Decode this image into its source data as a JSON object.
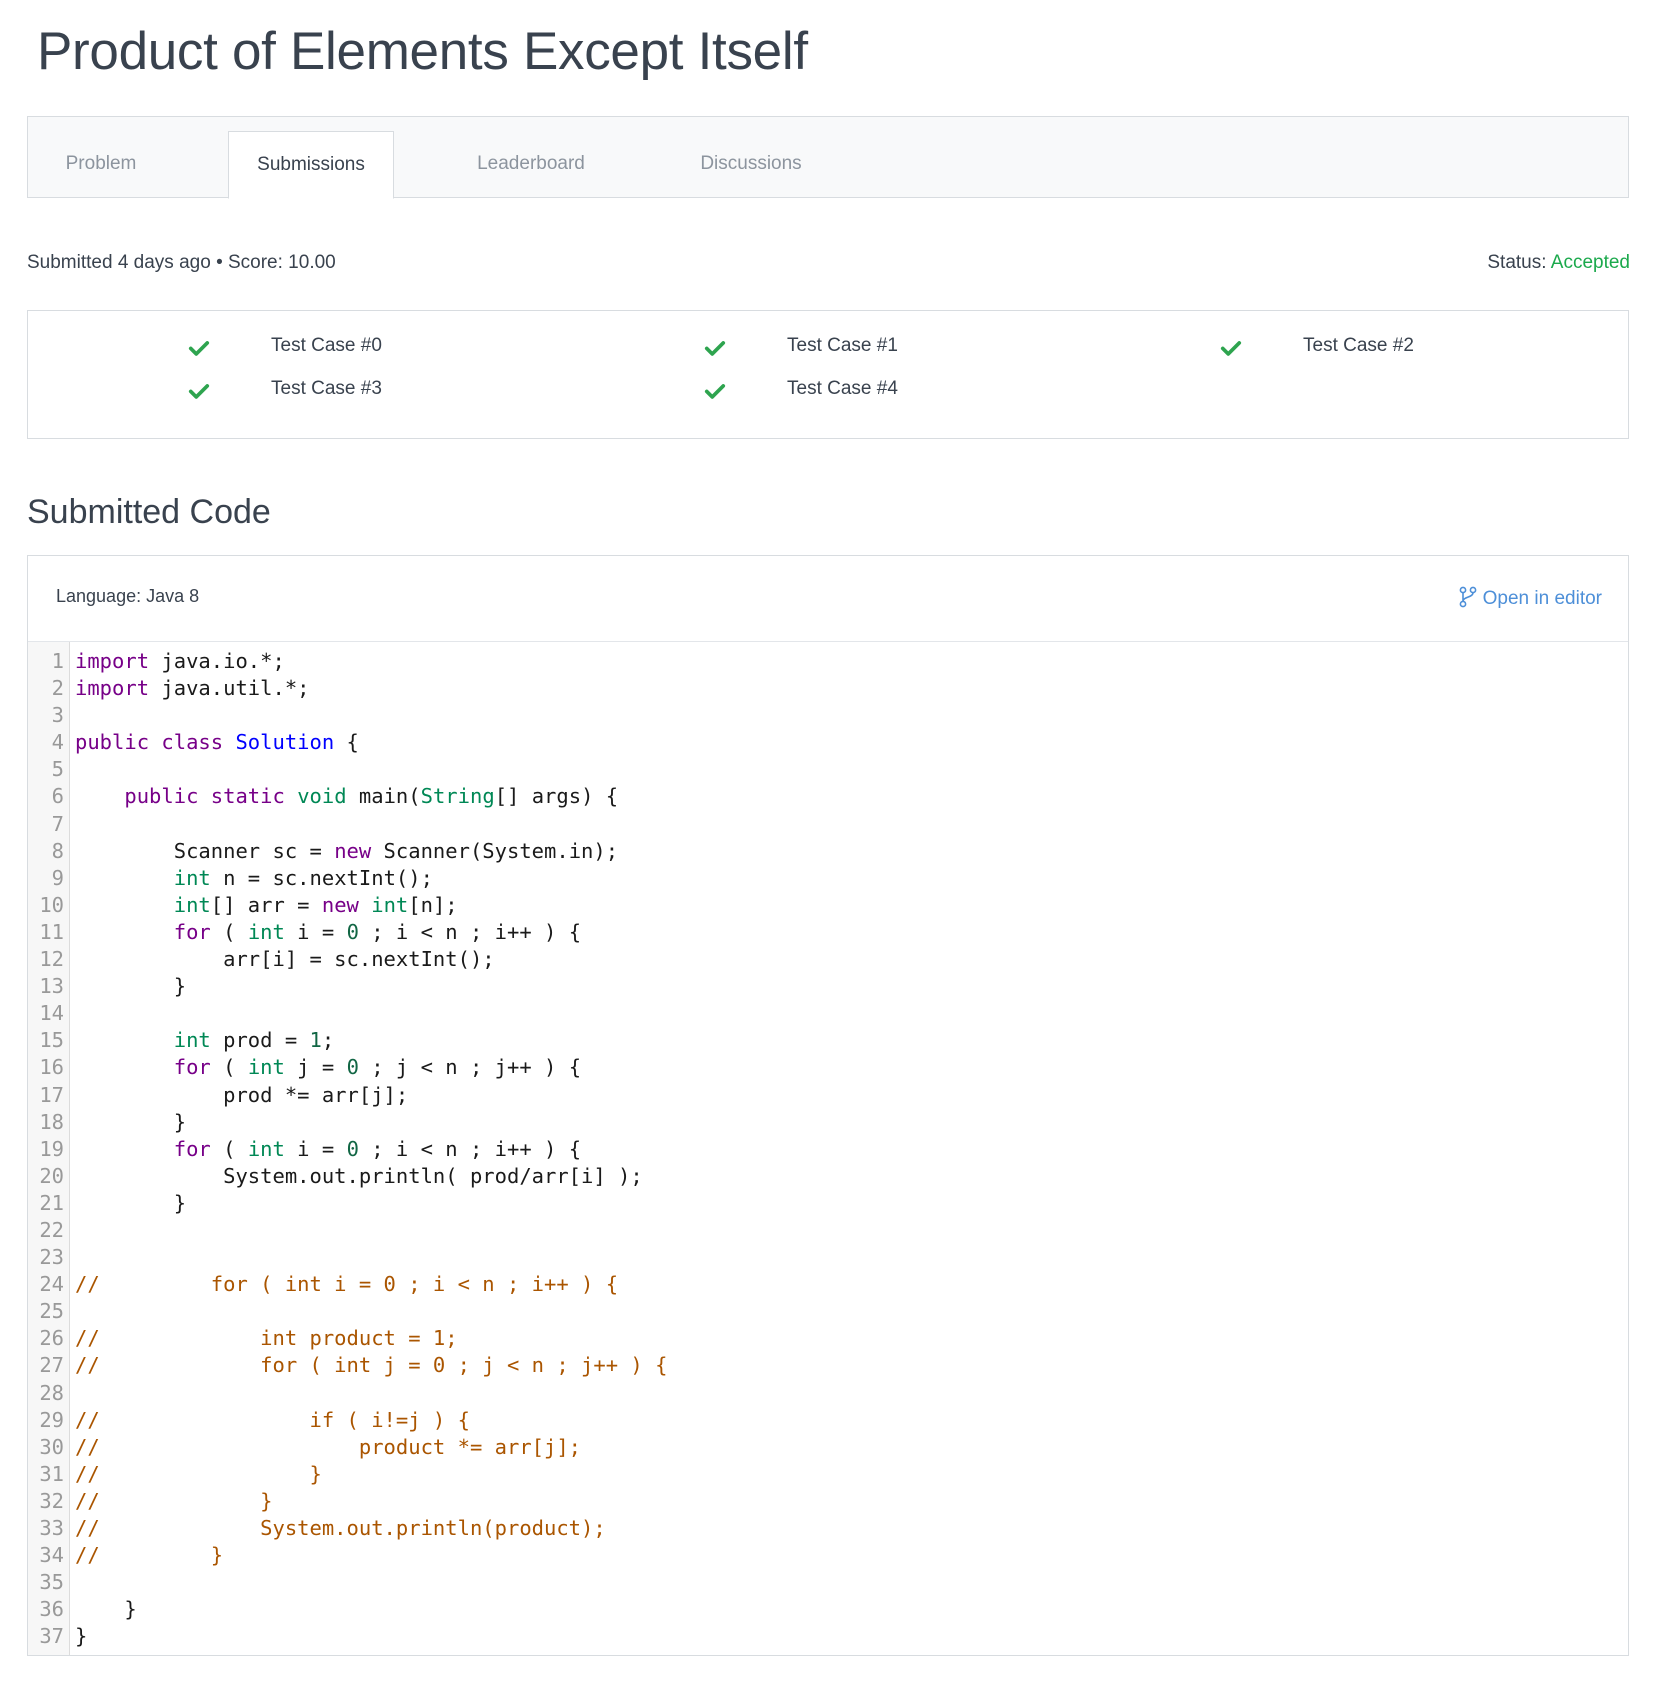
{
  "page": {
    "title": "Product of Elements Except Itself"
  },
  "tabs": [
    {
      "label": "Problem",
      "active": false
    },
    {
      "label": "Submissions",
      "active": true
    },
    {
      "label": "Leaderboard",
      "active": false
    },
    {
      "label": "Discussions",
      "active": false
    }
  ],
  "submission": {
    "meta_text": "Submitted 4 days ago • Score: 10.00",
    "status_label": "Status:",
    "status_value": "Accepted",
    "status_color": "#1ba94c"
  },
  "test_cases": [
    {
      "label": "Test Case #0",
      "icon": "check-icon",
      "passed": true
    },
    {
      "label": "Test Case #1",
      "icon": "check-icon",
      "passed": true
    },
    {
      "label": "Test Case #2",
      "icon": "check-icon",
      "passed": true
    },
    {
      "label": "Test Case #3",
      "icon": "check-icon",
      "passed": true
    },
    {
      "label": "Test Case #4",
      "icon": "check-icon",
      "passed": true
    }
  ],
  "code_section": {
    "title": "Submitted Code",
    "language": "Language: Java 8",
    "open_editor_label": "Open in editor",
    "open_editor_icon": "branch-icon",
    "link_color": "#4d8fd8"
  },
  "code_lines": [
    "import java.io.*;",
    "import java.util.*;",
    "",
    "public class Solution {",
    "",
    "    public static void main(String[] args) {",
    "",
    "        Scanner sc = new Scanner(System.in);",
    "        int n = sc.nextInt();",
    "        int[] arr = new int[n];",
    "        for ( int i = 0 ; i < n ; i++ ) {",
    "            arr[i] = sc.nextInt();",
    "        }",
    "",
    "        int prod = 1;",
    "        for ( int j = 0 ; j < n ; j++ ) {",
    "            prod *= arr[j];",
    "        }",
    "        for ( int i = 0 ; i < n ; i++ ) {",
    "            System.out.println( prod/arr[i] );",
    "        }",
    "",
    "",
    "//         for ( int i = 0 ; i < n ; i++ ) {",
    "",
    "//             int product = 1;",
    "//             for ( int j = 0 ; j < n ; j++ ) {",
    "",
    "//                 if ( i!=j ) {",
    "//                     product *= arr[j];",
    "//                 }",
    "//             }",
    "//             System.out.println(product);",
    "//         }",
    "",
    "    }",
    "}"
  ]
}
